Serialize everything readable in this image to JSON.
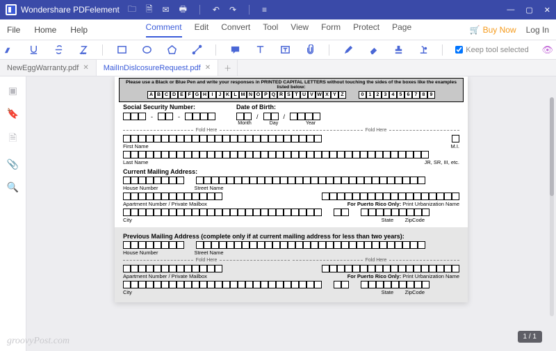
{
  "app": {
    "title": "Wondershare PDFelement"
  },
  "menu": {
    "left": [
      "File",
      "Home",
      "Help"
    ],
    "center": [
      "Comment",
      "Edit",
      "Convert",
      "Tool",
      "View",
      "Form",
      "Protect",
      "Page"
    ],
    "active": "Comment",
    "buy": "Buy Now",
    "login": "Log In"
  },
  "toolbar": {
    "keep_tool": "Keep tool selected"
  },
  "tabs": [
    {
      "name": "NewEggWarranty.pdf",
      "active": false
    },
    {
      "name": "MailInDislcosureRequest.pdf",
      "active": true
    }
  ],
  "doc": {
    "instruction": "Please use a Black or Blue Pen and write your responses in PRINTED CAPITAL LETTERS without touching the sides of the boxes like the examples listed below:",
    "alpha": [
      "A",
      "B",
      "C",
      "D",
      "E",
      "F",
      "G",
      "H",
      "I",
      "J",
      "K",
      "L",
      "M",
      "N",
      "O",
      "P",
      "Q",
      "R",
      "S",
      "T",
      "U",
      "V",
      "W",
      "X",
      "Y",
      "Z"
    ],
    "digits": [
      "0",
      "1",
      "2",
      "3",
      "4",
      "5",
      "6",
      "7",
      "8",
      "9"
    ],
    "ssn_label": "Social Security Number:",
    "dob_label": "Date of Birth:",
    "month": "Month",
    "day": "Day",
    "year": "Year",
    "fold": "Fold Here",
    "first_name": "First Name",
    "mi": "M.I.",
    "last_name": "Last Name",
    "suffix": "JR, SR, III, etc.",
    "current_addr": "Current Mailing Address:",
    "house_number": "House Number",
    "street_name": "Street Name",
    "apt": "Apartment Number / Private Mailbox",
    "pr": "For Puerto Rico Only:",
    "urban": "Print Urbanization Name",
    "city": "City",
    "state": "State",
    "zip": "ZipCode",
    "prev_addr": "Previous Mailing Address (complete only if at current mailing address for less than two years):"
  },
  "watermark": "groovyPost.com",
  "page_indicator": "1 / 1"
}
